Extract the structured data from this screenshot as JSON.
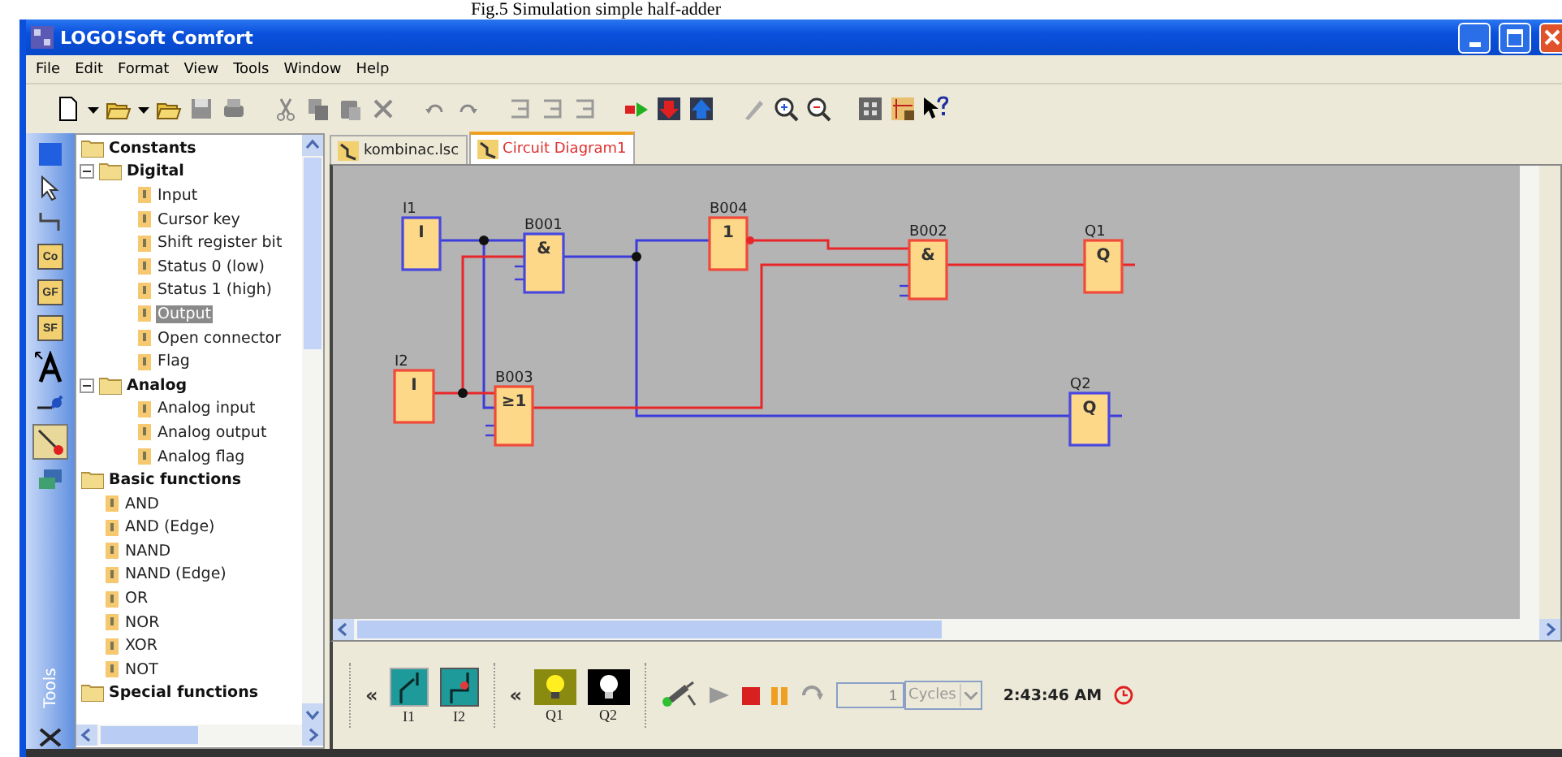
{
  "caption": "Fig.5 Simulation simple half-adder",
  "window": {
    "title": "LOGO!Soft Comfort"
  },
  "menu": [
    "File",
    "Edit",
    "Format",
    "View",
    "Tools",
    "Window",
    "Help"
  ],
  "tools": {
    "label": "Tools",
    "buttons": [
      "Co",
      "GF",
      "SF"
    ]
  },
  "tree": [
    {
      "label": "Constants",
      "children": [
        {
          "label": "Digital",
          "expanded": true,
          "children": [
            {
              "label": "Input",
              "selected": false
            },
            {
              "label": "Cursor key",
              "selected": false
            },
            {
              "label": "Shift register bit",
              "selected": false
            },
            {
              "label": "Status 0 (low)",
              "selected": false
            },
            {
              "label": "Status 1 (high)",
              "selected": false
            },
            {
              "label": "Output",
              "selected": true
            },
            {
              "label": "Open connector",
              "selected": false
            },
            {
              "label": "Flag",
              "selected": false
            }
          ]
        },
        {
          "label": "Analog",
          "expanded": true,
          "children": [
            {
              "label": "Analog input",
              "selected": false
            },
            {
              "label": "Analog output",
              "selected": false
            },
            {
              "label": "Analog flag",
              "selected": false
            }
          ]
        }
      ]
    },
    {
      "label": "Basic functions",
      "children": [
        {
          "label": "AND",
          "selected": false
        },
        {
          "label": "AND (Edge)",
          "selected": false
        },
        {
          "label": "NAND",
          "selected": false
        },
        {
          "label": "NAND (Edge)",
          "selected": false
        },
        {
          "label": "OR",
          "selected": false
        },
        {
          "label": "NOR",
          "selected": false
        },
        {
          "label": "XOR",
          "selected": false
        },
        {
          "label": "NOT",
          "selected": false
        }
      ]
    },
    {
      "label": "Special functions"
    }
  ],
  "tabs": [
    {
      "label": "kombinac.lsc",
      "selected": false
    },
    {
      "label": "Circuit Diagram1",
      "selected": true
    }
  ],
  "blocks": [
    {
      "label": "I1",
      "symbol": "I",
      "high": false
    },
    {
      "label": "I2",
      "symbol": "I",
      "high": true
    },
    {
      "label": "B001",
      "symbol": "&",
      "high": false
    },
    {
      "label": "B003",
      "symbol": "≥1",
      "high": true
    },
    {
      "label": "B004",
      "symbol": "1",
      "high": true
    },
    {
      "label": "B002",
      "symbol": "&",
      "high": true
    },
    {
      "label": "Q1",
      "symbol": "Q",
      "high": true
    },
    {
      "label": "Q2",
      "symbol": "Q",
      "high": false
    }
  ],
  "simulation": {
    "collapse": [
      "«",
      "«"
    ],
    "inputs": [
      {
        "label": "I1",
        "on": false
      },
      {
        "label": "I2",
        "on": true
      }
    ],
    "outputs": [
      {
        "label": "Q1",
        "on": true
      },
      {
        "label": "Q2",
        "on": false
      }
    ],
    "cycles": "1",
    "unit": "Cycles",
    "time": "2:43:46 AM"
  }
}
